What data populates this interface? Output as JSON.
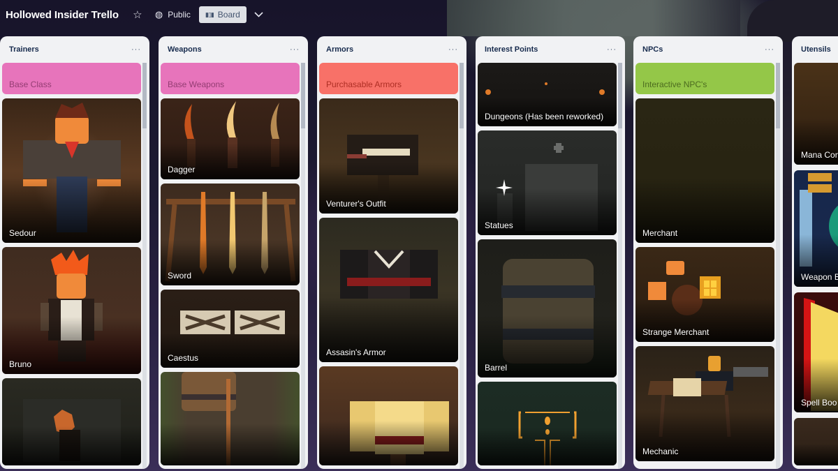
{
  "header": {
    "board_title": "Hollowed Insider Trello",
    "star_icon": "star-icon",
    "visibility_label": "Public",
    "visibility_icon": "globe-icon",
    "view_button_label": "Board",
    "view_button_icon": "board-icon",
    "view_dropdown_icon": "chevron-down-icon"
  },
  "lists": [
    {
      "title": "Trainers",
      "menu": "···",
      "cards": [
        {
          "type": "label",
          "text": "Base Class",
          "color": "#e774bb",
          "text_color": "#943d73"
        },
        {
          "type": "photo",
          "text": "Sedour"
        },
        {
          "type": "photo",
          "text": "Bruno"
        },
        {
          "type": "photo",
          "text": ""
        }
      ]
    },
    {
      "title": "Weapons",
      "menu": "···",
      "cards": [
        {
          "type": "label",
          "text": "Base Weapons",
          "color": "#e774bb",
          "text_color": "#943d73"
        },
        {
          "type": "photo",
          "text": "Dagger"
        },
        {
          "type": "photo",
          "text": "Sword"
        },
        {
          "type": "photo",
          "text": "Caestus"
        },
        {
          "type": "photo",
          "text": ""
        }
      ]
    },
    {
      "title": "Armors",
      "menu": "···",
      "cards": [
        {
          "type": "label",
          "text": "Purchasable Armors",
          "color": "#f87168",
          "text_color": "#ae2e24"
        },
        {
          "type": "photo",
          "text": "Venturer's Outfit"
        },
        {
          "type": "photo",
          "text": "Assasin's Armor"
        },
        {
          "type": "photo",
          "text": ""
        }
      ]
    },
    {
      "title": "Interest Points",
      "menu": "···",
      "cards": [
        {
          "type": "photo",
          "text": "Dungeons (Has been reworked)"
        },
        {
          "type": "photo",
          "text": "Statues"
        },
        {
          "type": "photo",
          "text": "Barrel"
        },
        {
          "type": "photo",
          "text": ""
        }
      ]
    },
    {
      "title": "NPCs",
      "menu": "···",
      "cards": [
        {
          "type": "label",
          "text": "Interactive NPC's",
          "color": "#94c748",
          "text_color": "#4c6b1f"
        },
        {
          "type": "photo",
          "text": "Merchant"
        },
        {
          "type": "photo",
          "text": "Strange Merchant"
        },
        {
          "type": "photo",
          "text": "Mechanic"
        }
      ]
    },
    {
      "title": "Utensils",
      "menu": "···",
      "cards": [
        {
          "type": "photo",
          "text": "Mana Con"
        },
        {
          "type": "photo",
          "text": "Weapon B"
        },
        {
          "type": "photo",
          "text": "Spell Boo"
        },
        {
          "type": "photo",
          "text": ""
        }
      ]
    }
  ]
}
